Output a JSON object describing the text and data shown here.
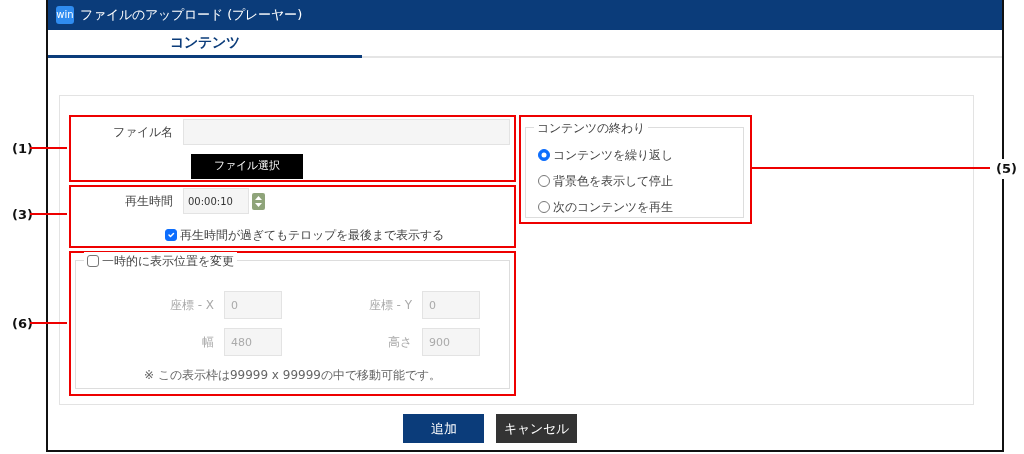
{
  "window": {
    "title": "ファイルのアップロード (プレーヤー)",
    "logo": "win"
  },
  "tabs": [
    {
      "label": "コンテンツ",
      "selected": true
    }
  ],
  "file": {
    "label": "ファイル名",
    "button": "ファイル選択"
  },
  "duration": {
    "label": "再生時間",
    "value": "00:00:10",
    "keep_caption": {
      "label": "再生時間が過ぎてもテロップを最後まで表示する",
      "checked": true
    }
  },
  "position": {
    "label": "一時的に表示位置を変更",
    "checked": false,
    "fields": [
      {
        "label": "座標 - X",
        "value": "0"
      },
      {
        "label": "座標 - Y",
        "value": "0"
      },
      {
        "label": "幅",
        "value": "480"
      },
      {
        "label": "高さ",
        "value": "900"
      }
    ],
    "note": "※ この表示枠は99999 x 99999の中で移動可能です。"
  },
  "content_end": {
    "legend": "コンテンツの終わり",
    "options": [
      {
        "label": "コンテンツを繰り返し",
        "selected": true
      },
      {
        "label": "背景色を表示して停止",
        "selected": false
      },
      {
        "label": "次のコンテンツを再生",
        "selected": false
      }
    ]
  },
  "buttons": [
    {
      "label": "追加",
      "kind": "primary"
    },
    {
      "label": "キャンセル",
      "kind": "secondary"
    }
  ],
  "callouts": [
    "(1)",
    "(3)",
    "(5)",
    "(6)"
  ]
}
